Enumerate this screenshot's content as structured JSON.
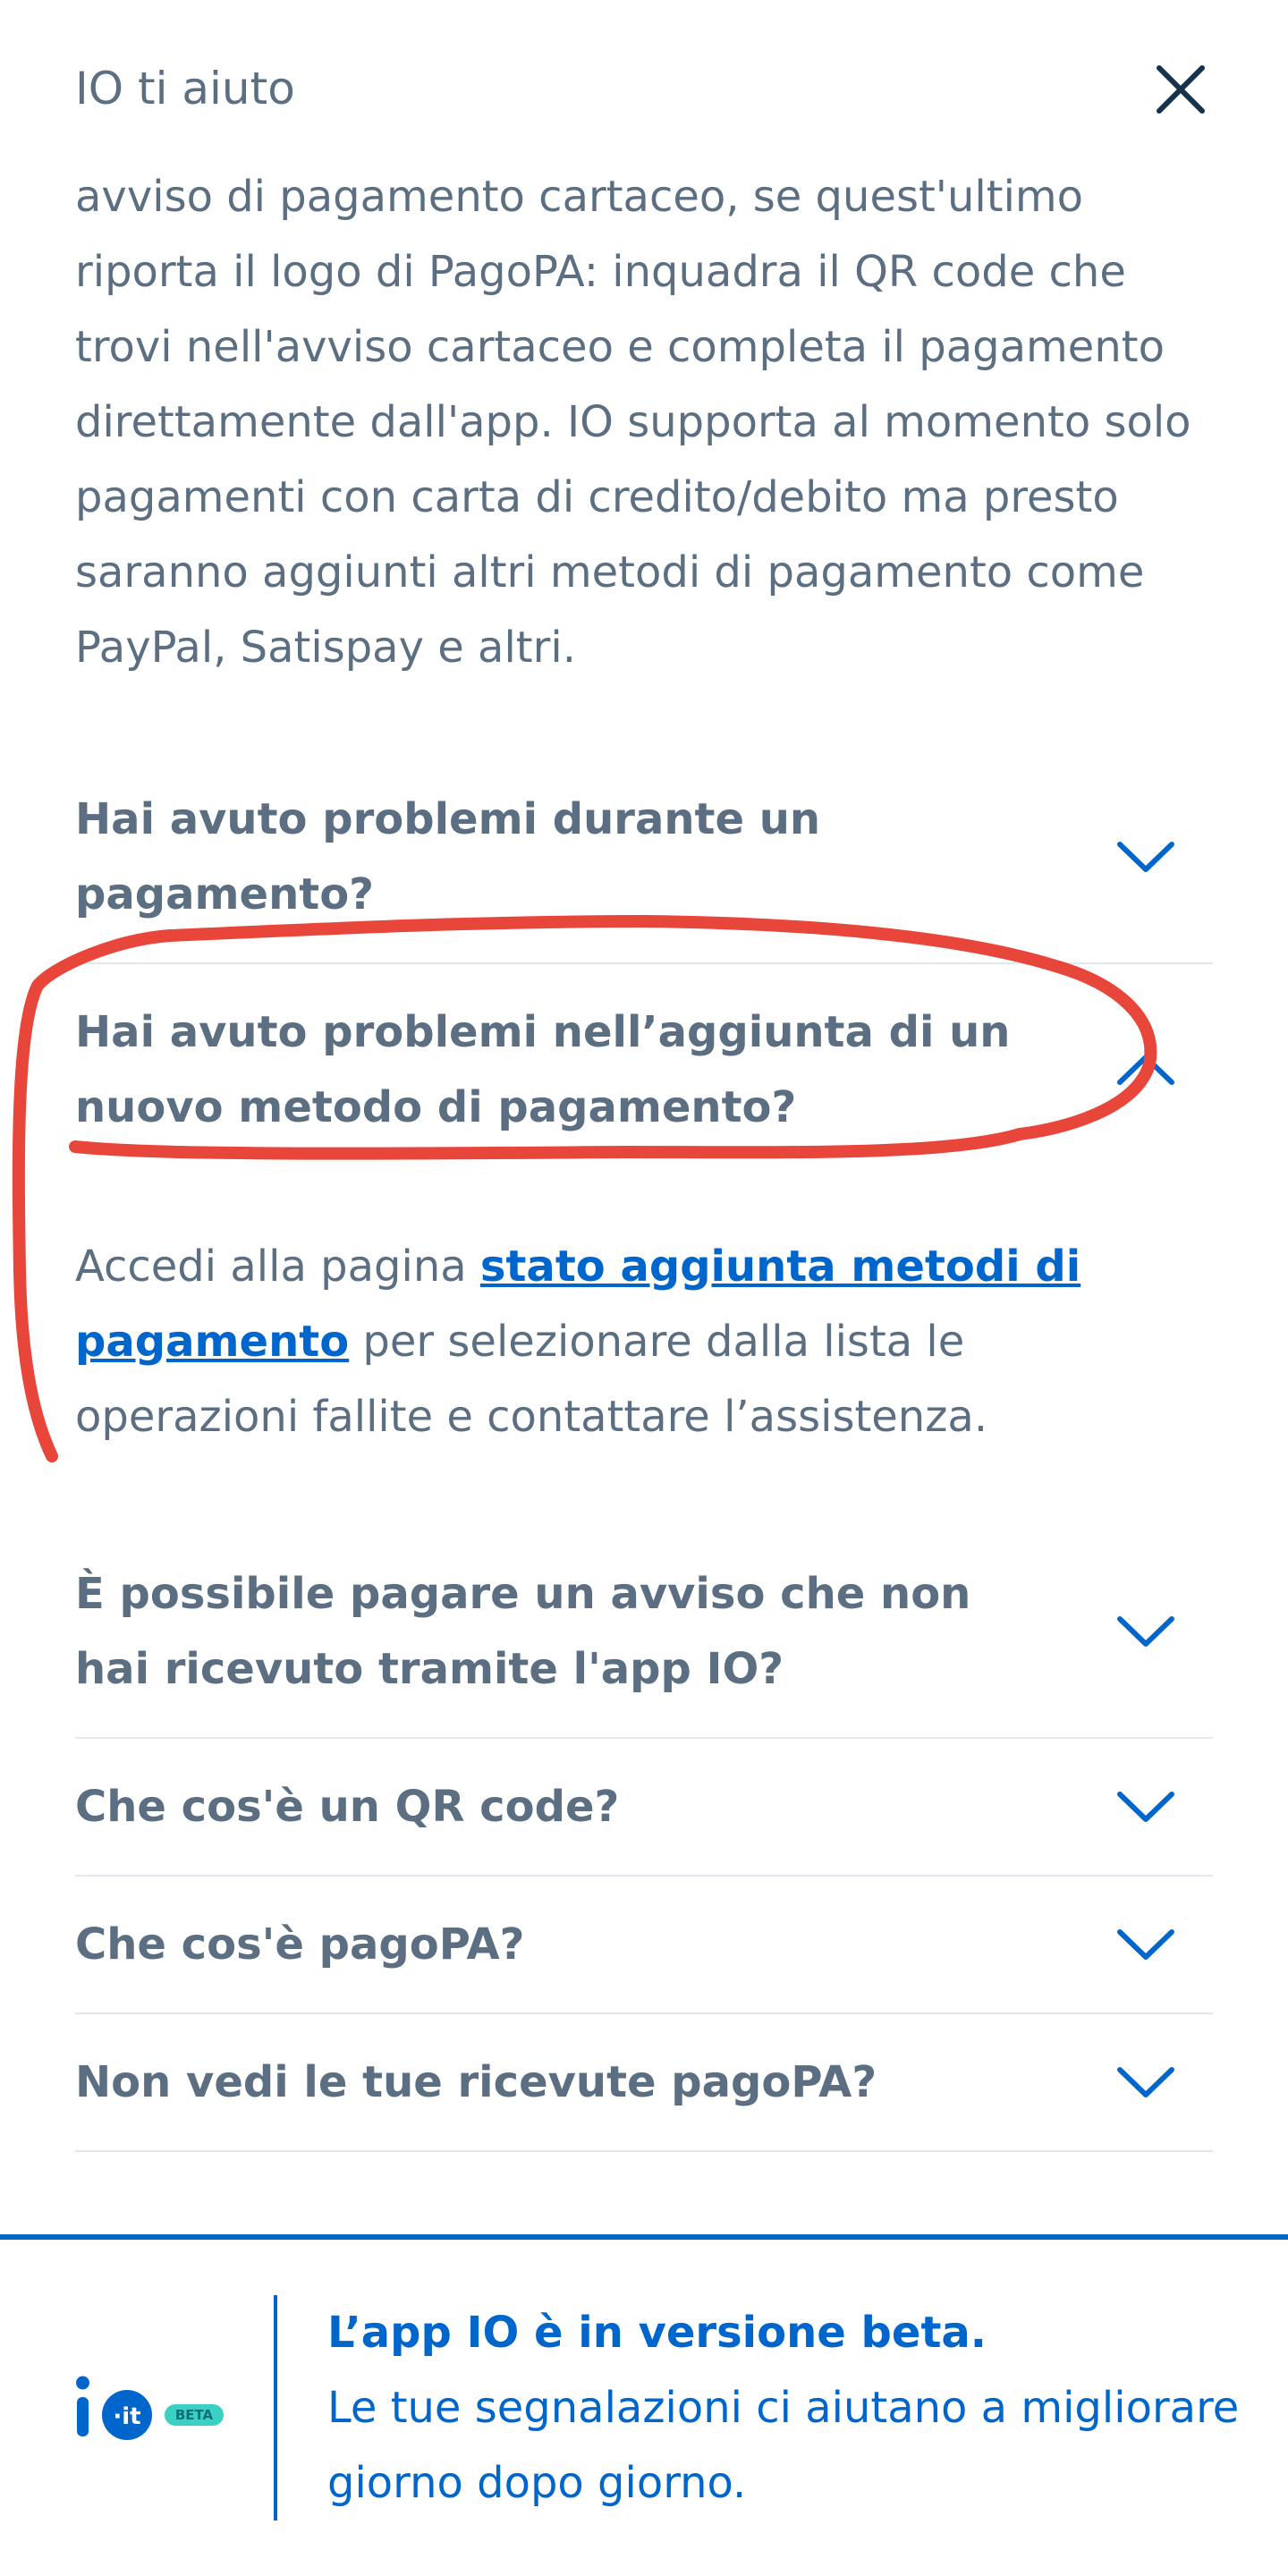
{
  "header": {
    "title": "IO ti aiuto",
    "close_icon": "close-icon"
  },
  "intro": "avviso di pagamento cartaceo, se quest'ultimo riporta il logo di PagoPA: inquadra il QR code che trovi nell'avviso cartaceo e completa il pagamento direttamente dall'app. IO supporta al momento solo pagamenti con carta di credito/debito ma presto saranno aggiunti altri metodi di pagamento come PayPal, Satispay e altri.",
  "faq": {
    "items": [
      {
        "question": "Hai avuto problemi durante un pagamento?",
        "expanded": false
      },
      {
        "question": "Hai avuto problemi nell’aggiunta di un nuovo metodo di pagamento?",
        "expanded": true,
        "answer_before": "Accedi alla pagina ",
        "answer_link": "stato aggiunta metodi di pagamento",
        "answer_after": " per selezionare dalla lista le operazioni fallite e contattare l’assistenza."
      },
      {
        "question": "È possibile pagare un avviso che non hai ricevuto tramite l'app IO?",
        "expanded": false
      },
      {
        "question": "Che cos'è un QR code?",
        "expanded": false
      },
      {
        "question": "Che cos'è pagoPA?",
        "expanded": false
      },
      {
        "question": "Non vedi le tue ricevute pagoPA?",
        "expanded": false
      }
    ]
  },
  "footer": {
    "logo_badge": "BETA",
    "title": "L’app IO è in versione beta.",
    "body": "Le tue segnalazioni ci aiutano a migliorare giorno dopo giorno."
  },
  "colors": {
    "text": "#5c6f82",
    "accent": "#0066cc",
    "divider": "#e3e8ee",
    "annotation": "#e8463a",
    "badge": "#3ad1c4"
  }
}
